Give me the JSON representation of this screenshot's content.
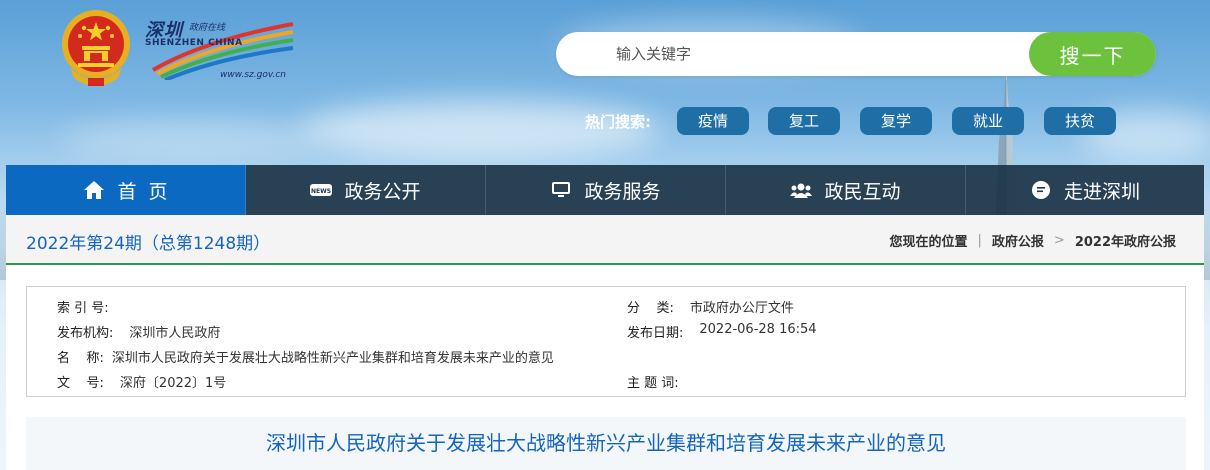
{
  "brand": {
    "cn_name": "深圳",
    "cn_sub": "政府在线",
    "en_name": "SHENZHEN CHINA",
    "url": "www.sz.gov.cn"
  },
  "search": {
    "placeholder": "输入关键字",
    "button_label": "搜一下"
  },
  "hot_search": {
    "label": "热门搜索:",
    "tags": [
      "疫情",
      "复工",
      "复学",
      "就业",
      "扶贫"
    ]
  },
  "nav": {
    "items": [
      {
        "label": "首  页",
        "icon": "home-icon"
      },
      {
        "label": "政务公开",
        "icon": "news-icon"
      },
      {
        "label": "政务服务",
        "icon": "monitor-icon"
      },
      {
        "label": "政民互动",
        "icon": "users-icon"
      },
      {
        "label": "走进深圳",
        "icon": "chat-icon"
      }
    ],
    "active_index": 0
  },
  "issue": {
    "title": "2022年第24期（总第1248期）"
  },
  "breadcrumb": {
    "prefix": "您现在的位置",
    "items": [
      "政府公报",
      "2022年政府公报"
    ]
  },
  "meta": {
    "index_label": "索 引 号:",
    "index_value": "",
    "category_label": "分    类:",
    "category_value": "市政府办公厅文件",
    "publisher_label": "发布机构:",
    "publisher_value": "深圳市人民政府",
    "date_label": "发布日期:",
    "date_value": "2022-06-28 16:54",
    "name_label": "名    称:",
    "name_value": "深圳市人民政府关于发展壮大战略性新兴产业集群和培育发展未来产业的意见",
    "docno_label": "文    号:",
    "docno_value": "深府〔2022〕1号",
    "subject_label": "主 题 词:",
    "subject_value": ""
  },
  "document": {
    "title": "深圳市人民政府关于发展壮大战略性新兴产业集群和培育发展未来产业的意见"
  },
  "colors": {
    "nav_active": "#0c69c1",
    "nav_bg": "#1c3448",
    "search_button": "#6cc23c",
    "hot_tag": "#1f6fa6",
    "link_blue": "#1565c0",
    "divider_green": "#2a9a4a"
  }
}
